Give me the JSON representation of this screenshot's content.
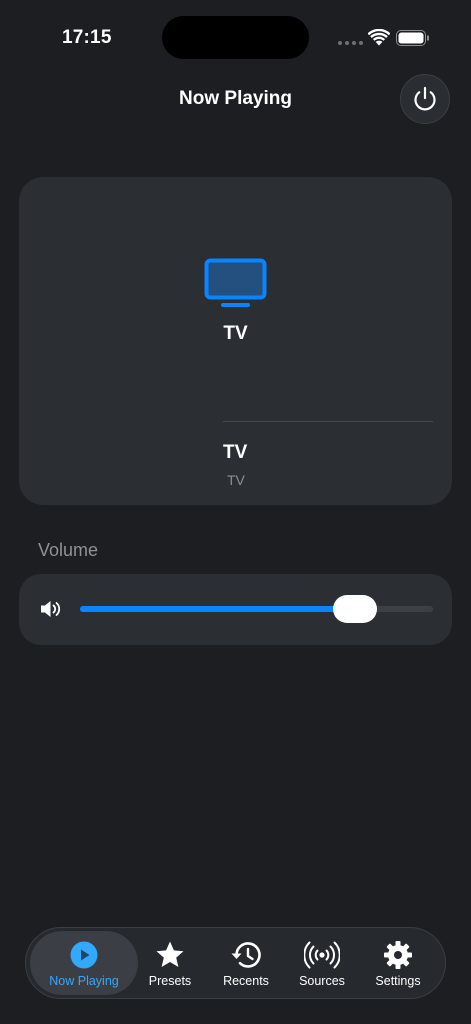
{
  "status_bar": {
    "time": "17:15"
  },
  "header": {
    "title": "Now Playing"
  },
  "now_playing": {
    "source_name": "TV",
    "track_title": "TV",
    "track_subtitle": "TV"
  },
  "volume": {
    "label": "Volume",
    "level": 0.78
  },
  "tabs": [
    {
      "label": "Now Playing",
      "icon": "play-circle-icon",
      "active": true
    },
    {
      "label": "Presets",
      "icon": "star-icon",
      "active": false
    },
    {
      "label": "Recents",
      "icon": "history-icon",
      "active": false
    },
    {
      "label": "Sources",
      "icon": "broadcast-icon",
      "active": false
    },
    {
      "label": "Settings",
      "icon": "gear-icon",
      "active": false
    }
  ],
  "colors": {
    "accent": "#0a84ff",
    "background": "#1c1e21",
    "card": "#2b2e33"
  }
}
